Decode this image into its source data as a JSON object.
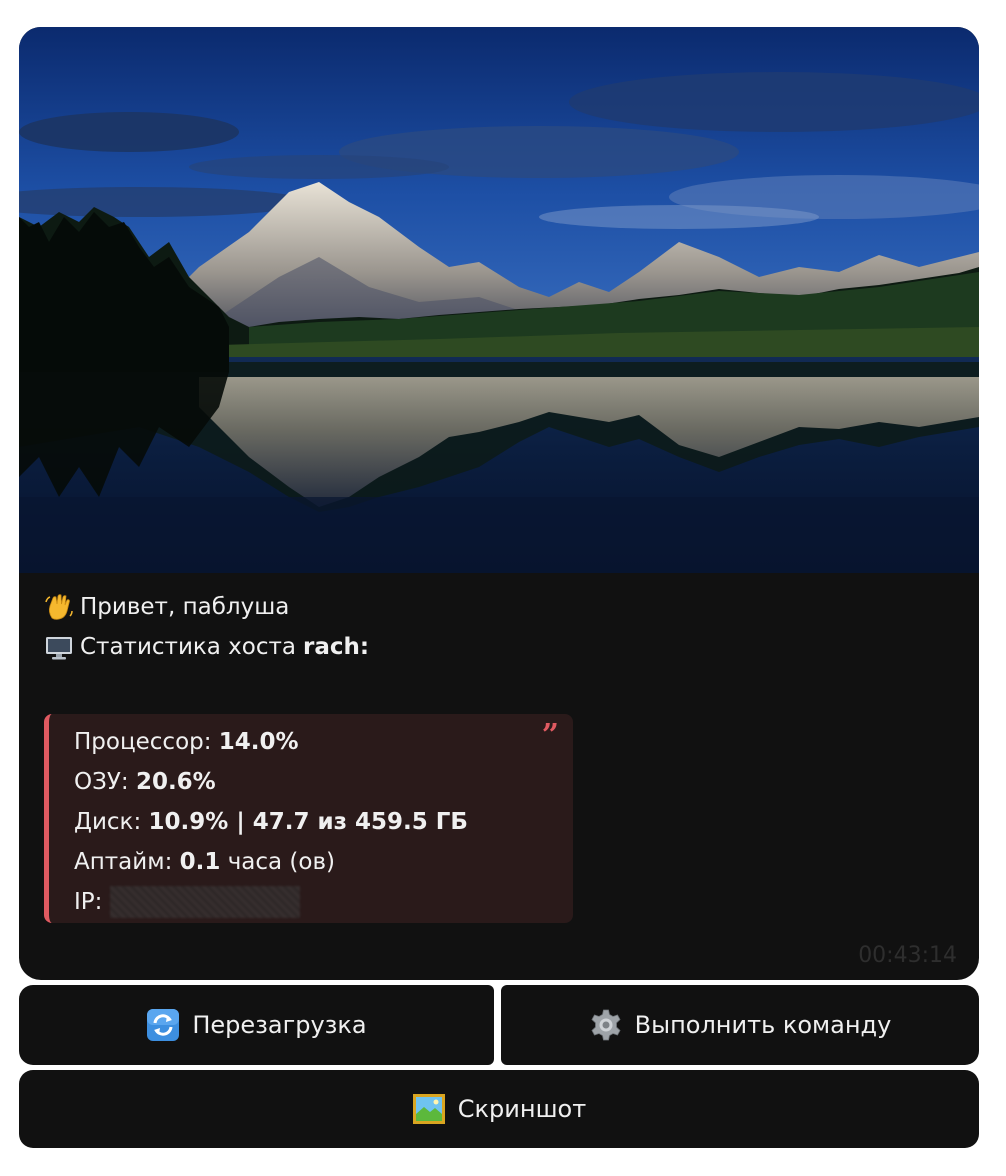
{
  "message": {
    "greeting_emoji": "waving-hand-icon",
    "greeting": "Привет, паблуша",
    "stats_emoji": "desktop-computer-icon",
    "stats_label": "Статистика хоста",
    "host": "rach:",
    "stats": {
      "cpu_label": "Процессор:",
      "cpu_value": "14.0%",
      "ram_label": "ОЗУ:",
      "ram_value": "20.6%",
      "disk_label": "Диск:",
      "disk_value": "10.9% | 47.7 из 459.5 ГБ",
      "uptime_label": "Аптайм:",
      "uptime_value": "0.1",
      "uptime_unit": "часа (ов)",
      "ip_label": "IP:"
    },
    "time": "00:43:14"
  },
  "buttons": {
    "reboot": {
      "label": "Перезагрузка",
      "icon": "refresh-icon"
    },
    "execute": {
      "label": "Выполнить команду",
      "icon": "gear-icon"
    },
    "screenshot": {
      "label": "Скриншот",
      "icon": "picture-icon"
    }
  },
  "colors": {
    "bubble_bg": "#111111",
    "quote_bg": "#2a1a1a",
    "quote_accent": "#e05a61"
  }
}
